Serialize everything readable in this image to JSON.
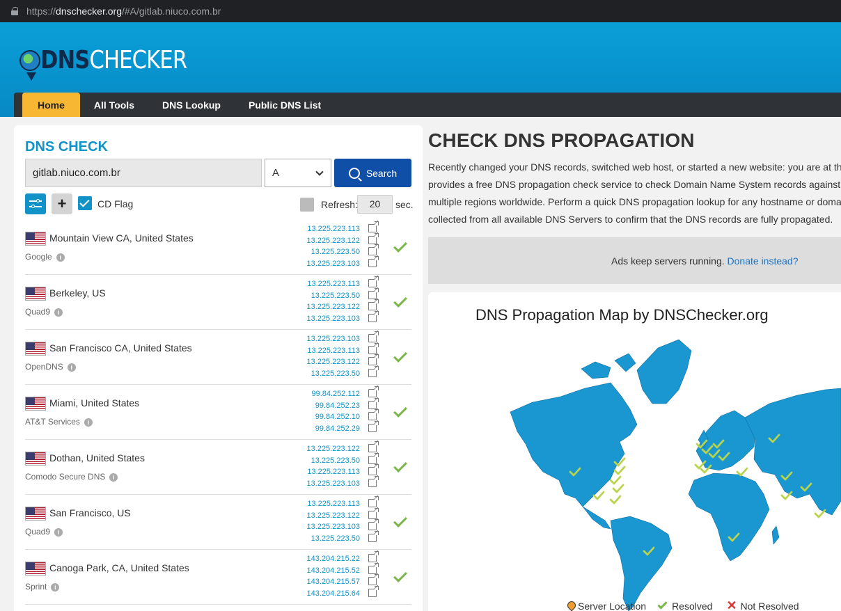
{
  "browser": {
    "url_prefix": "https://",
    "url_host": "dnschecker.org",
    "url_rest": "/#A/gitlab.niuco.com.br"
  },
  "logo": {
    "part1": "DNS",
    "part2": "CHECKER"
  },
  "nav": [
    "Home",
    "All Tools",
    "DNS Lookup",
    "Public DNS List"
  ],
  "check": {
    "heading": "DNS CHECK",
    "domain": "gitlab.niuco.com.br",
    "record_type": "A",
    "search_label": "Search",
    "cd_flag_label": "CD Flag",
    "refresh_label": "Refresh:",
    "refresh_value": "20",
    "refresh_unit": "sec."
  },
  "servers": [
    {
      "location": "Mountain View CA, United States",
      "provider": "Google",
      "ips": [
        "13.225.223.113",
        "13.225.223.122",
        "13.225.223.50",
        "13.225.223.103"
      ]
    },
    {
      "location": "Berkeley, US",
      "provider": "Quad9",
      "ips": [
        "13.225.223.113",
        "13.225.223.50",
        "13.225.223.122",
        "13.225.223.103"
      ]
    },
    {
      "location": "San Francisco CA, United States",
      "provider": "OpenDNS",
      "ips": [
        "13.225.223.103",
        "13.225.223.113",
        "13.225.223.122",
        "13.225.223.50"
      ]
    },
    {
      "location": "Miami, United States",
      "provider": "AT&T Services",
      "ips": [
        "99.84.252.112",
        "99.84.252.23",
        "99.84.252.10",
        "99.84.252.29"
      ]
    },
    {
      "location": "Dothan, United States",
      "provider": "Comodo Secure DNS",
      "ips": [
        "13.225.223.122",
        "13.225.223.50",
        "13.225.223.113",
        "13.225.223.103"
      ]
    },
    {
      "location": "San Francisco, US",
      "provider": "Quad9",
      "ips": [
        "13.225.223.113",
        "13.225.223.122",
        "13.225.223.103",
        "13.225.223.50"
      ]
    },
    {
      "location": "Canoga Park, CA, United States",
      "provider": "Sprint",
      "ips": [
        "143.204.215.22",
        "143.204.215.52",
        "143.204.215.57",
        "143.204.215.64"
      ]
    }
  ],
  "main": {
    "title": "CHECK DNS PROPAGATION",
    "desc_lines": [
      "Recently changed your DNS records, switched web host, or started a new website: you are at the",
      "provides a free DNS propagation check service to check Domain Name System records against a",
      "multiple regions worldwide. Perform a quick DNS propagation lookup for any hostname or doma",
      "collected from all available DNS Servers to confirm that the DNS records are fully propagated."
    ],
    "ads_text": "Ads keep servers running.",
    "ads_link": "Donate instead?",
    "map_title": "DNS Propagation Map by DNSChecker.org",
    "legend": {
      "server": "Server Location",
      "resolved": "Resolved",
      "not_resolved": "Not Resolved"
    }
  },
  "colors": {
    "brand_blue": "#1193c8",
    "nav_dark": "#2f3237",
    "nav_active": "#f7b733",
    "search_btn": "#0f4fa8",
    "resolved_green": "#7ab648",
    "map_land": "#1a96d1"
  }
}
